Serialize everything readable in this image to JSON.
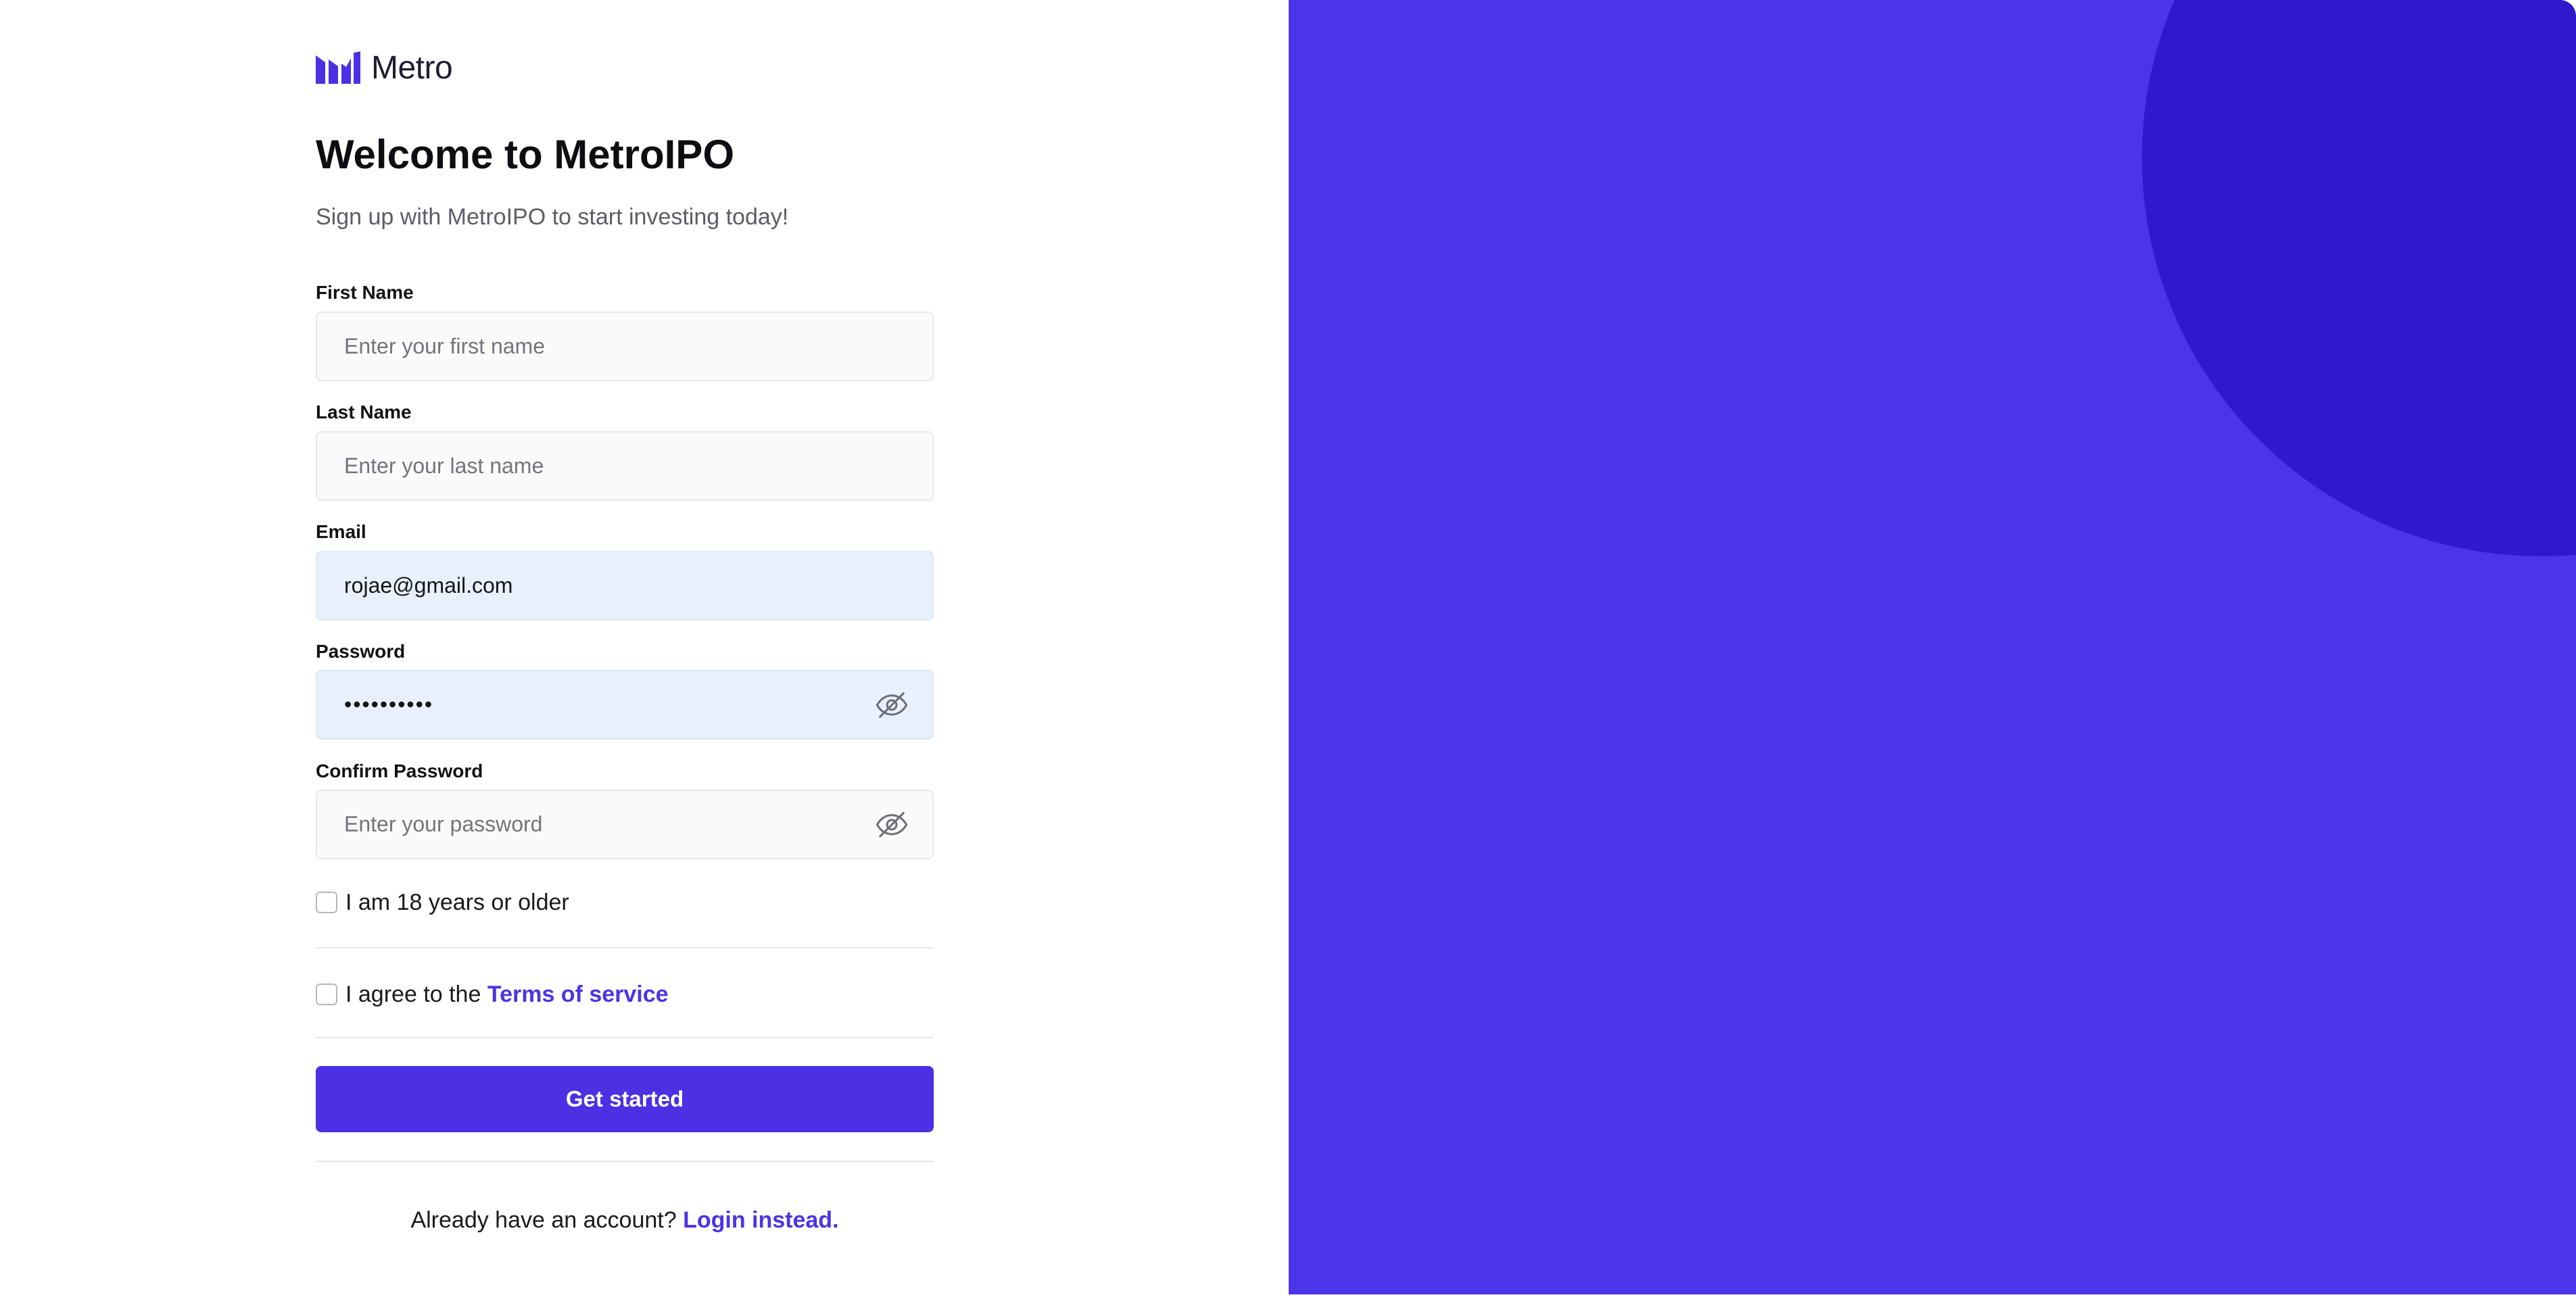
{
  "brand": {
    "name": "Metro",
    "color": "#4b30e4",
    "logo_icon": "metro-bars-logo"
  },
  "header": {
    "title": "Welcome to MetroIPO",
    "subtitle": "Sign up with MetroIPO to start investing today!"
  },
  "form": {
    "first_name": {
      "label": "First Name",
      "value": "",
      "placeholder": "Enter your first name"
    },
    "last_name": {
      "label": "Last Name",
      "value": "",
      "placeholder": "Enter your last name"
    },
    "email": {
      "label": "Email",
      "value": "rojae@gmail.com",
      "placeholder": ""
    },
    "password": {
      "label": "Password",
      "value": "••••••••••",
      "placeholder": "",
      "toggle_icon": "eye-off-icon"
    },
    "confirm_password": {
      "label": "Confirm Password",
      "value": "",
      "placeholder": "Enter your password",
      "toggle_icon": "eye-off-icon"
    },
    "age_check": {
      "label": "I am 18 years or older",
      "checked": false
    },
    "terms_check": {
      "prefix": "I agree to the",
      "link": "Terms of service",
      "checked": false
    },
    "submit_label": "Get started"
  },
  "footer": {
    "prompt": "Already have an account?",
    "link": "Login instead."
  },
  "colors": {
    "panel": "#4c35e9",
    "panel_circle": "#3218cd",
    "link": "#4b34e5",
    "autofill_bg": "#e8f0fe"
  }
}
